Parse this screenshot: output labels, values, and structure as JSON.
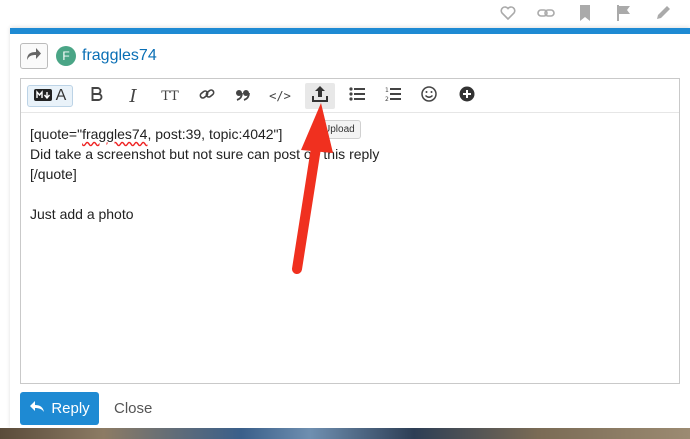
{
  "icons": {
    "heart": "heart-icon",
    "link": "link-icon",
    "bookmark": "bookmark-icon",
    "flag": "flag-icon",
    "edit": "pencil-icon"
  },
  "composer": {
    "username": "fraggles74",
    "avatar_letter": "F",
    "toolbar": {
      "mode_letter": "A",
      "italic": "I",
      "heading": "TT",
      "code": "</>",
      "tooltip": "Upload"
    },
    "text_lines": [
      "[quote=\"fraggles74, post:39, topic:4042\"]",
      "Did take a screenshot but not sure can post on this reply",
      "[/quote]",
      "",
      "Just add a photo"
    ],
    "reply_label": "Reply",
    "close_label": "Close"
  },
  "colors": {
    "accent": "#1e8ad3",
    "username": "#0a6fb5",
    "avatar": "#4aa586",
    "annotation_arrow": "#f0301f"
  }
}
